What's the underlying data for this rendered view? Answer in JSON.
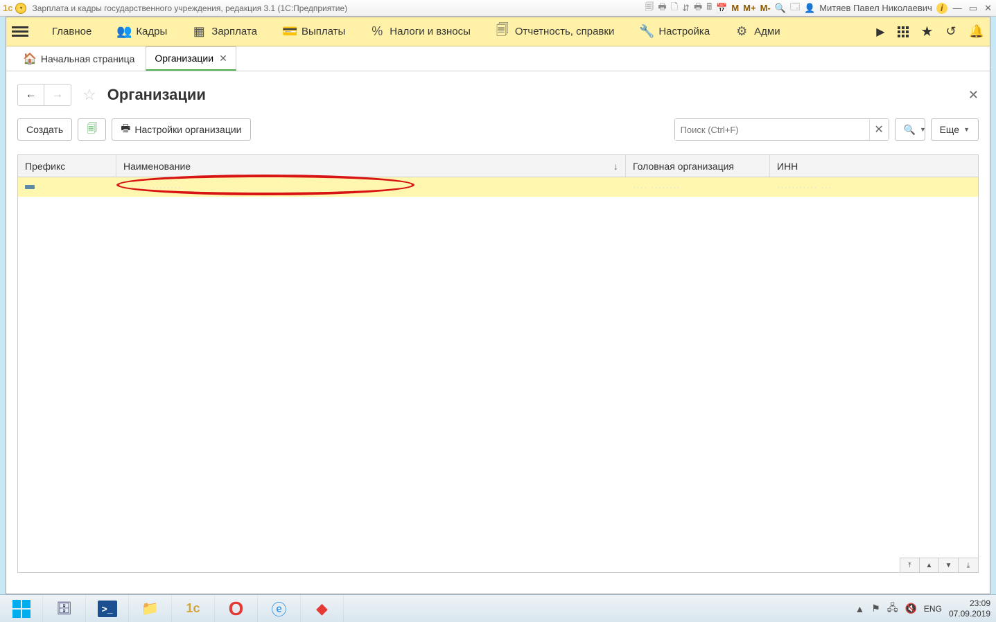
{
  "titlebar": {
    "app_title": "Зарплата и кадры государственного учреждения, редакция 3.1  (1С:Предприятие)",
    "m": "M",
    "m_plus": "M+",
    "m_minus": "M-",
    "user": "Митяев Павел Николаевич"
  },
  "ribbon": {
    "items": [
      {
        "label": "Главное"
      },
      {
        "label": "Кадры"
      },
      {
        "label": "Зарплата"
      },
      {
        "label": "Выплаты"
      },
      {
        "label": "Налоги и взносы"
      },
      {
        "label": "Отчетность, справки"
      },
      {
        "label": "Настройка"
      },
      {
        "label": "Адми"
      }
    ]
  },
  "tabs": {
    "home": "Начальная страница",
    "active": "Организации"
  },
  "page": {
    "title": "Организации"
  },
  "toolbar": {
    "create": "Создать",
    "settings": "Настройки организации",
    "search_placeholder": "Поиск (Ctrl+F)",
    "more": "Еще"
  },
  "table": {
    "cols": {
      "prefix": "Префикс",
      "name": "Наименование",
      "head": "Головная организация",
      "inn": "ИНН"
    },
    "row": {
      "name": "··· ·· ·········",
      "head": "···· ········",
      "inn": "··········· ···"
    }
  },
  "taskbar": {
    "lang": "ENG",
    "time": "23:09",
    "date": "07.09.2019"
  }
}
